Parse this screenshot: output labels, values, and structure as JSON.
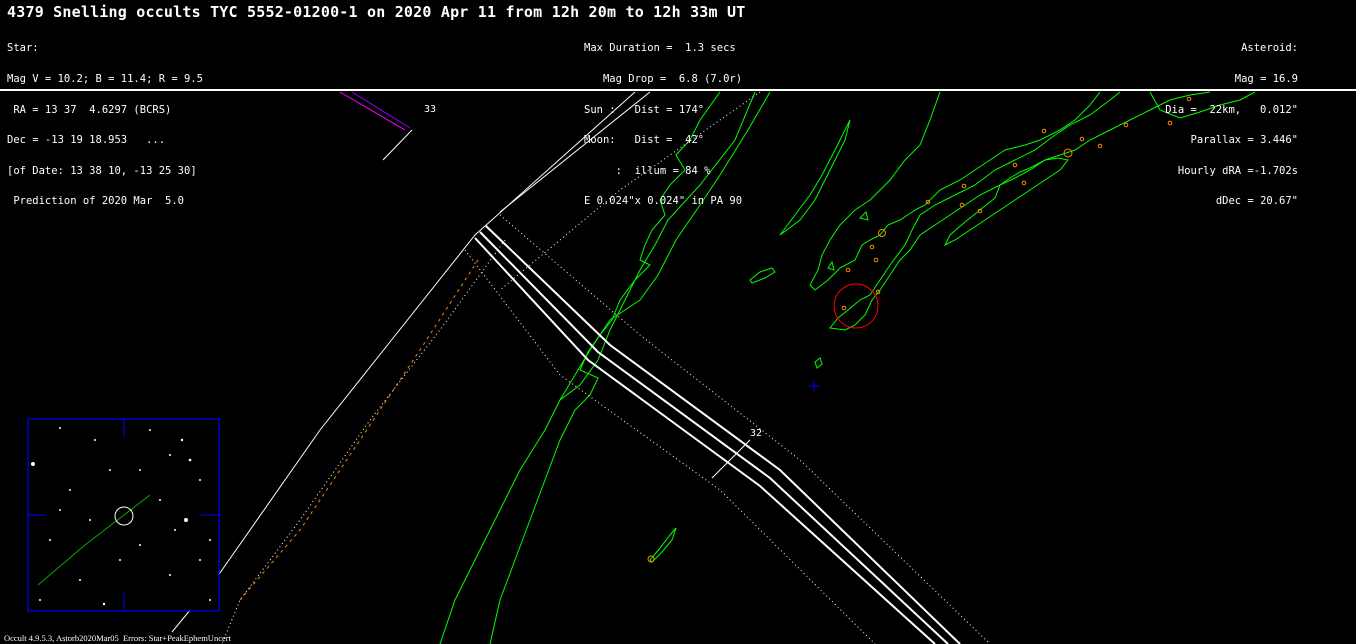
{
  "title": "4379 Snelling occults TYC 5552-01200-1 on 2020 Apr 11 from 12h 20m to 12h 33m UT",
  "star_block": [
    "Star:",
    "Mag V = 10.2; B = 11.4; R = 9.5",
    " RA = 13 37  4.6297 (BCRS)",
    "Dec = -13 19 18.953   ...",
    "[of Date: 13 38 10, -13 25 30]",
    " Prediction of 2020 Mar  5.0"
  ],
  "event_block": [
    "Max Duration =  1.3 secs",
    "   Mag Drop =  6.8 (7.0r)",
    "Sun :   Dist = 174°",
    "Moon:   Dist =  42°",
    "     :  illum = 84 %",
    "E 0.024\"x 0.024\" in PA 90"
  ],
  "asteroid_block": [
    "Asteroid:",
    "Mag = 16.9",
    "Dia =  22km,   0.012\"",
    "Parallax = 3.446\"",
    "Hourly dRA =-1.702s",
    "dDec = 20.67\""
  ],
  "time_labels": {
    "upper": "33",
    "lower": "32"
  },
  "footer": "Occult 4.9.5.3, Astorb2020Mar05  Errors: Star+PeakEphemUncert",
  "colors": {
    "background": "#000000",
    "path": "#ffffff",
    "coastline": "#00ff00",
    "error_bounds": "#ff8800",
    "site_circle": "#ff0000",
    "cross_marker": "#0000ff",
    "inset_frame": "#0000ff"
  }
}
